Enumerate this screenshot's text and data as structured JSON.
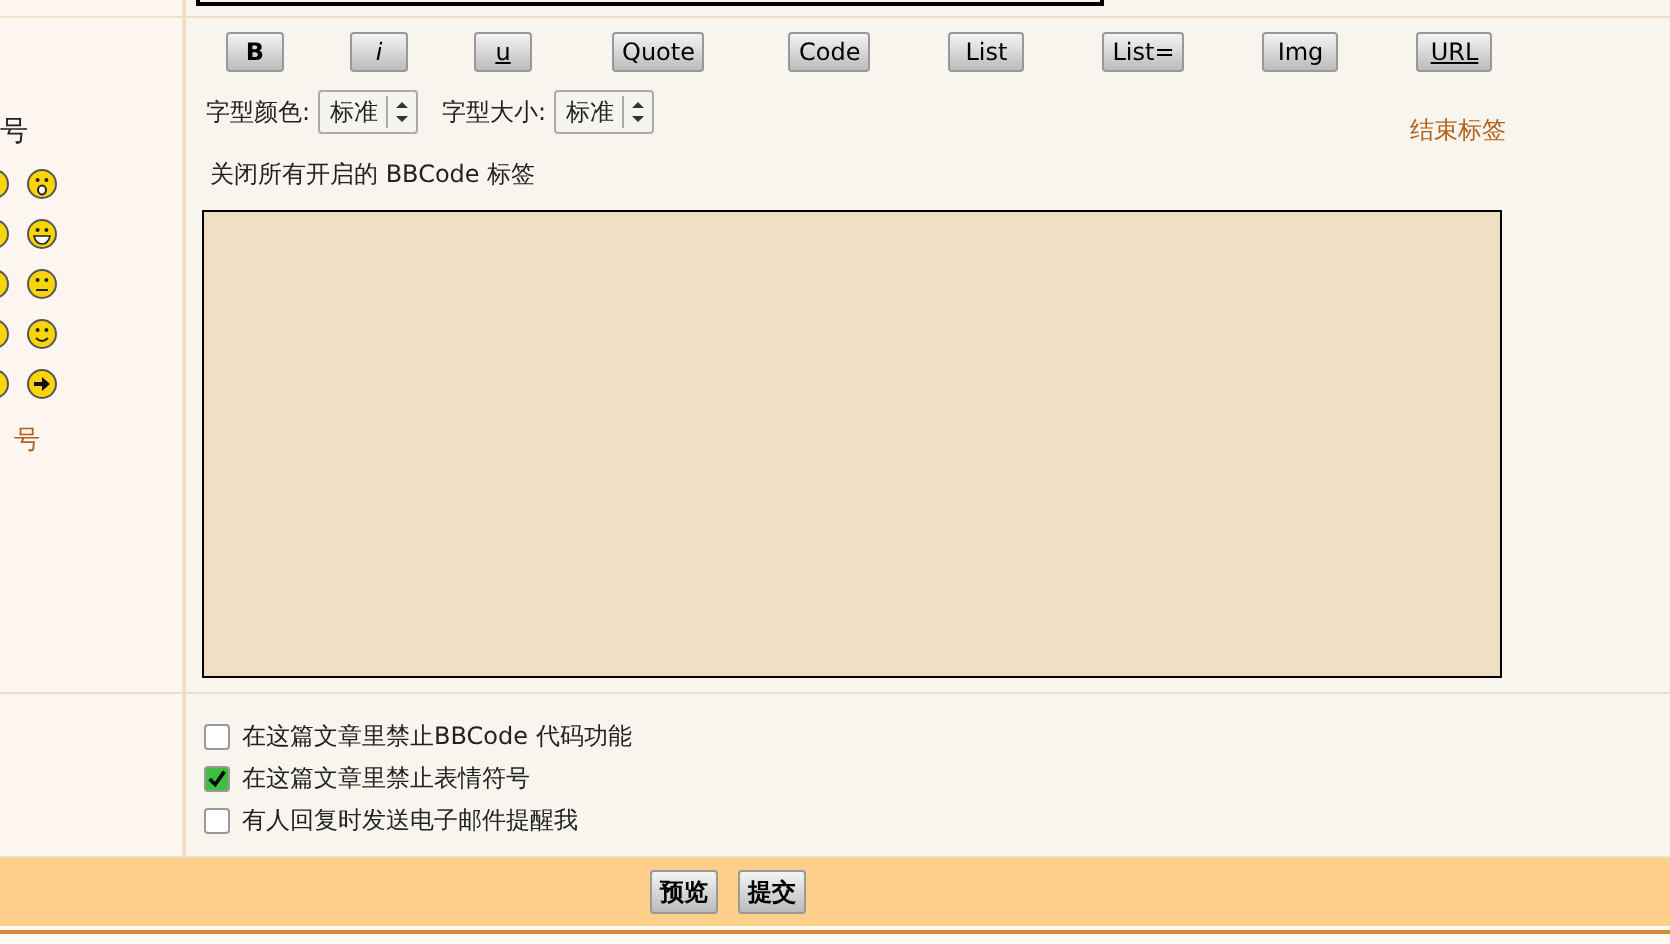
{
  "left_panel": {
    "heading": "号",
    "more_link": "号"
  },
  "toolbar": {
    "buttons": [
      {
        "label": "B",
        "kind": "bold"
      },
      {
        "label": "i",
        "kind": "italic"
      },
      {
        "label": "u",
        "kind": "underline"
      },
      {
        "label": "Quote",
        "kind": "plain"
      },
      {
        "label": "Code",
        "kind": "plain"
      },
      {
        "label": "List",
        "kind": "plain"
      },
      {
        "label": "List=",
        "kind": "plain"
      },
      {
        "label": "Img",
        "kind": "plain"
      },
      {
        "label": "URL",
        "kind": "underline"
      }
    ]
  },
  "font_color": {
    "label": "字型颜色:",
    "value": "标准"
  },
  "font_size": {
    "label": "字型大小:",
    "value": "标准"
  },
  "close_tags_link": "结束标签",
  "hint": "关闭所有开启的 BBCode 标签",
  "options": [
    {
      "label": "在这篇文章里禁止BBCode 代码功能",
      "checked": false
    },
    {
      "label": "在这篇文章里禁止表情符号",
      "checked": true
    },
    {
      "label": "有人回复时发送电子邮件提醒我",
      "checked": false
    }
  ],
  "actions": [
    "预览",
    "提交"
  ]
}
